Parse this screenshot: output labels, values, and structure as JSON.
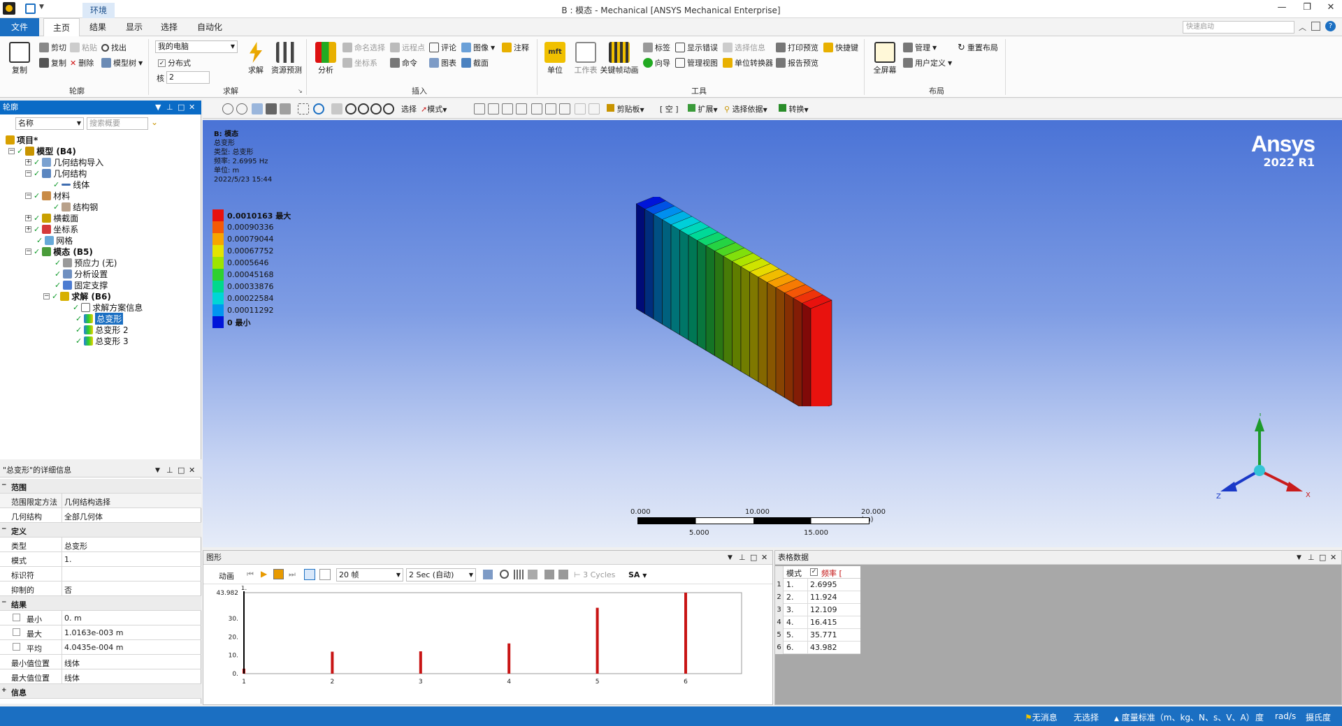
{
  "window": {
    "title": "B : 模态 - Mechanical [ANSYS Mechanical Enterprise]"
  },
  "tabs": {
    "file": "文件",
    "home": "主页",
    "results": "结果",
    "display": "显示",
    "selection": "选择",
    "automation": "自动化",
    "environment": "环境"
  },
  "quick_search": {
    "placeholder": "快速启动"
  },
  "ribbon": {
    "outline": {
      "label": "轮廓",
      "copy": "复制",
      "cut": "剪切",
      "paste": "粘贴",
      "find": "找出",
      "duplicate": "复制",
      "delete": "删除",
      "tree": "模型树"
    },
    "solve": {
      "label": "求解",
      "computer": "我的电脑",
      "distributed": "分布式",
      "cores_label": "核",
      "cores": "2",
      "solve_btn": "求解",
      "resource": "资源预测"
    },
    "insert": {
      "label": "插入",
      "analysis": "分析",
      "named_sel": "命名选择",
      "remote_pt": "远程点",
      "comment": "评论",
      "image": "图像",
      "annotation": "注释",
      "coord": "坐标系",
      "command": "命令",
      "chart": "图表",
      "section": "截面"
    },
    "tools": {
      "label": "工具",
      "units": "单位",
      "worksheet": "工作表",
      "keyframe": "关键帧动画",
      "tag": "标签",
      "show_err": "显示错误",
      "sel_info": "选择信息",
      "print_preview": "打印预览",
      "shortcut": "快捷键",
      "wizard": "向导",
      "manage_view": "管理视图",
      "unit_conv": "单位转换器",
      "report_preview": "报告预览"
    },
    "layout": {
      "label": "布局",
      "fullscreen": "全屏幕",
      "manage": "管理",
      "reset": "重置布局",
      "user_def": "用户定义"
    }
  },
  "toolbar": {
    "select": "选择",
    "mode": "模式",
    "clipboard": "剪贴板",
    "empty": "[ 空 ]",
    "extend": "扩展",
    "select_by": "选择依据",
    "convert": "转换"
  },
  "outline": {
    "title": "轮廓",
    "name_filter": "名称",
    "search_placeholder": "搜索概要",
    "items": [
      "项目*",
      "模型 (B4)",
      "几何结构导入",
      "几何结构",
      "线体",
      "材料",
      "结构钢",
      "横截面",
      "坐标系",
      "网格",
      "模态 (B5)",
      "预应力 (无)",
      "分析设置",
      "固定支撑",
      "求解 (B6)",
      "求解方案信息",
      "总变形",
      "总变形 2",
      "总变形 3"
    ]
  },
  "details": {
    "title": "\"总变形\"的详细信息",
    "sections": {
      "scope": "范围",
      "definition": "定义",
      "results": "结果",
      "info": "信息"
    },
    "rows": {
      "scope_method_k": "范围限定方法",
      "scope_method_v": "几何结构选择",
      "geometry_k": "几何结构",
      "geometry_v": "全部几何体",
      "type_k": "类型",
      "type_v": "总变形",
      "mode_k": "模式",
      "mode_v": "1.",
      "identifier_k": "标识符",
      "identifier_v": "",
      "suppressed_k": "抑制的",
      "suppressed_v": "否",
      "min_k": "最小",
      "min_v": "0. m",
      "max_k": "最大",
      "max_v": "1.0163e-003 m",
      "avg_k": "平均",
      "avg_v": "4.0435e-004 m",
      "min_loc_k": "最小值位置",
      "min_loc_v": "线体",
      "max_loc_k": "最大值位置",
      "max_loc_v": "线体"
    }
  },
  "viewport": {
    "info": {
      "title": "B: 模态",
      "type_line": "总变形",
      "type2": "类型: 总变形",
      "freq": "频率: 2.6995   Hz",
      "unit": "单位: m",
      "date": "2022/5/23 15:44"
    },
    "brand": {
      "name": "Ansys",
      "version": "2022 R1"
    },
    "legend": [
      {
        "label": "0.0010163 最大",
        "color": "#e8120e"
      },
      {
        "label": "0.00090336",
        "color": "#f55a06"
      },
      {
        "label": "0.00079044",
        "color": "#f7a500"
      },
      {
        "label": "0.00067752",
        "color": "#e4e400"
      },
      {
        "label": "0.0005646",
        "color": "#9ee400"
      },
      {
        "label": "0.00045168",
        "color": "#2fd12f"
      },
      {
        "label": "0.00033876",
        "color": "#00d98c"
      },
      {
        "label": "0.00022584",
        "color": "#00d6d6"
      },
      {
        "label": "0.00011292",
        "color": "#0096f0"
      },
      {
        "label": "0 最小",
        "color": "#0015d9"
      }
    ],
    "scale": {
      "t0": "0.000",
      "t10": "10.000",
      "t20": "20.000 (m)",
      "t5": "5.000",
      "t15": "15.000"
    },
    "axes": {
      "x": "X",
      "y": "Y",
      "z": "Z"
    }
  },
  "graph": {
    "title": "图形",
    "animation": "动画",
    "frames": "20 帧",
    "duration": "2 Sec (自动)",
    "cycles": "3 Cycles",
    "sa": "SA"
  },
  "chart_data": {
    "type": "bar",
    "categories": [
      "1",
      "2",
      "3",
      "4",
      "5",
      "6"
    ],
    "values": [
      2.6995,
      11.924,
      12.109,
      16.415,
      35.771,
      43.982
    ],
    "yticks": [
      "0.",
      "10.",
      "20.",
      "30.",
      "43.982"
    ],
    "ylim": [
      0,
      43.982
    ],
    "cursor_label": "1.",
    "bar_color": "#c81414"
  },
  "table": {
    "title": "表格数据",
    "col_mode": "模式",
    "col_freq": "频率 [",
    "rows": [
      {
        "idx": "1",
        "mode": "1.",
        "freq": "2.6995"
      },
      {
        "idx": "2",
        "mode": "2.",
        "freq": "11.924"
      },
      {
        "idx": "3",
        "mode": "3.",
        "freq": "12.109"
      },
      {
        "idx": "4",
        "mode": "4.",
        "freq": "16.415"
      },
      {
        "idx": "5",
        "mode": "5.",
        "freq": "35.771"
      },
      {
        "idx": "6",
        "mode": "6.",
        "freq": "43.982"
      }
    ]
  },
  "status": {
    "messages": "无消息",
    "selection": "无选择",
    "units": "度量标准（m、kg、N、s、V、A）",
    "deg": "度",
    "rad": "rad/s",
    "temp": "摄氏度"
  }
}
